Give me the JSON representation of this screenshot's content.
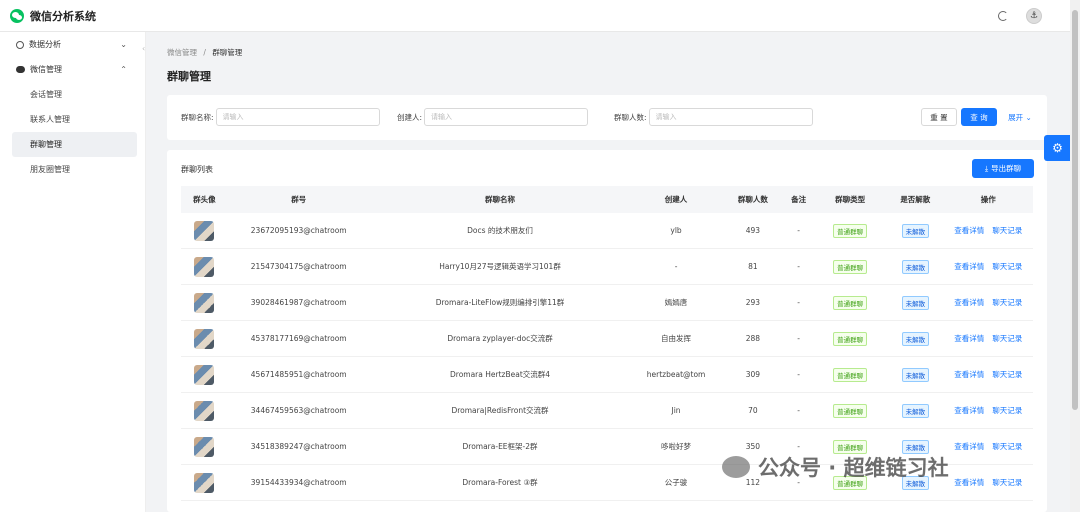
{
  "app": {
    "title": "微信分析系统"
  },
  "sidebar": {
    "groups": [
      {
        "label": "数据分析",
        "chevron": "⌄"
      },
      {
        "label": "微信管理",
        "chevron": "⌃"
      }
    ],
    "items": [
      {
        "label": "会话管理"
      },
      {
        "label": "联系人管理"
      },
      {
        "label": "群聊管理"
      },
      {
        "label": "朋友圈管理"
      }
    ]
  },
  "breadcrumb": {
    "parent": "微信管理",
    "separator": "/",
    "current": "群聊管理"
  },
  "page": {
    "title": "群聊管理"
  },
  "search": {
    "name_label": "群聊名称:",
    "name_placeholder": "请输入",
    "creator_label": "创建人:",
    "creator_placeholder": "请输入",
    "count_label": "群聊人数:",
    "count_placeholder": "请输入",
    "reset_label": "重 置",
    "query_label": "查 询",
    "expand_label": "展开 ⌄"
  },
  "table": {
    "title": "群聊列表",
    "export_label": "导出群聊",
    "headers": [
      "群头像",
      "群号",
      "群聊名称",
      "创建人",
      "群聊人数",
      "备注",
      "群聊类型",
      "是否解散",
      "操作"
    ],
    "rows": [
      {
        "id": "23672095193@chatroom",
        "name": "Docs 的技术朋友们",
        "creator": "ylb",
        "count": "493",
        "note": "-",
        "type": "普通群聊",
        "dissolved": "未解散"
      },
      {
        "id": "21547304175@chatroom",
        "name": "Harry10月27号逻辑英语学习101群",
        "creator": "-",
        "count": "81",
        "note": "-",
        "type": "普通群聊",
        "dissolved": "未解散"
      },
      {
        "id": "39028461987@chatroom",
        "name": "Dromara-LiteFlow规则编排引擎11群",
        "creator": "嫣嫣唐",
        "count": "293",
        "note": "-",
        "type": "普通群聊",
        "dissolved": "未解散"
      },
      {
        "id": "45378177169@chatroom",
        "name": "Dromara zyplayer-doc交流群",
        "creator": "自由发挥",
        "count": "288",
        "note": "-",
        "type": "普通群聊",
        "dissolved": "未解散"
      },
      {
        "id": "45671485951@chatroom",
        "name": "Dromara HertzBeat交流群4",
        "creator": "hertzbeat@tom",
        "count": "309",
        "note": "-",
        "type": "普通群聊",
        "dissolved": "未解散"
      },
      {
        "id": "34467459563@chatroom",
        "name": "Dromara|RedisFront交流群",
        "creator": "Jin",
        "count": "70",
        "note": "-",
        "type": "普通群聊",
        "dissolved": "未解散"
      },
      {
        "id": "34518389247@chatroom",
        "name": "Dromara-EE框架-2群",
        "creator": "哆啦好梦",
        "count": "350",
        "note": "-",
        "type": "普通群聊",
        "dissolved": "未解散"
      },
      {
        "id": "39154433934@chatroom",
        "name": "Dromara-Forest ③群",
        "creator": "公子骏",
        "count": "112",
        "note": "-",
        "type": "普通群聊",
        "dissolved": "未解散"
      }
    ],
    "actions": {
      "detail": "查看详情",
      "chat": "聊天记录"
    }
  },
  "watermark": {
    "text": "公众号 · 超维链习社"
  },
  "colors": {
    "primary": "#1677ff",
    "wechat_green": "#07c160"
  },
  "icons": [
    "wechat-logo-icon",
    "refresh-icon",
    "user-avatar-icon",
    "dashboard-icon",
    "wechat-icon",
    "chevron-icon",
    "export-icon",
    "gear-icon"
  ]
}
